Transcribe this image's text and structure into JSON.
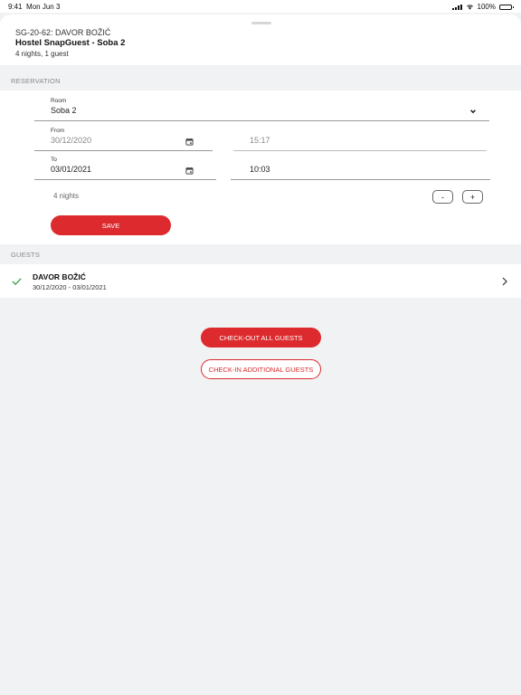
{
  "status_bar": {
    "time": "9:41",
    "date": "Mon Jun 3",
    "battery": "100%",
    "battery_level": 1.0
  },
  "header": {
    "code": "SG-20-62: DAVOR BOŽIĆ",
    "title": "Hostel SnapGuest - Soba 2",
    "subtitle": "4 nights, 1 guest"
  },
  "reservation": {
    "section_label": "RESERVATION",
    "room_label": "Room",
    "room_value": "Soba 2",
    "from_label": "From",
    "from_date": "30/12/2020",
    "from_time": "15:17",
    "to_label": "To",
    "to_date": "03/01/2021",
    "to_time": "10:03",
    "nights": "4 nights",
    "decrement": "-",
    "increment": "+",
    "save_label": "SAVE"
  },
  "guests": {
    "section_label": "GUESTS",
    "items": [
      {
        "name": "DAVOR BOŽIĆ",
        "dates": "30/12/2020 - 03/01/2021",
        "checked_in": true
      }
    ]
  },
  "actions": {
    "checkout_all": "CHECK-OUT ALL GUESTS",
    "checkin_additional": "CHECK-IN ADDITIONAL GUESTS"
  },
  "colors": {
    "accent": "#dc2a2e",
    "success": "#3aa348",
    "background": "#f1f2f4"
  },
  "icons": {
    "room_dropdown": "chevron-down-icon",
    "date_picker": "calendar-icon",
    "guest_status": "check-icon",
    "guest_open": "chevron-right-icon"
  }
}
